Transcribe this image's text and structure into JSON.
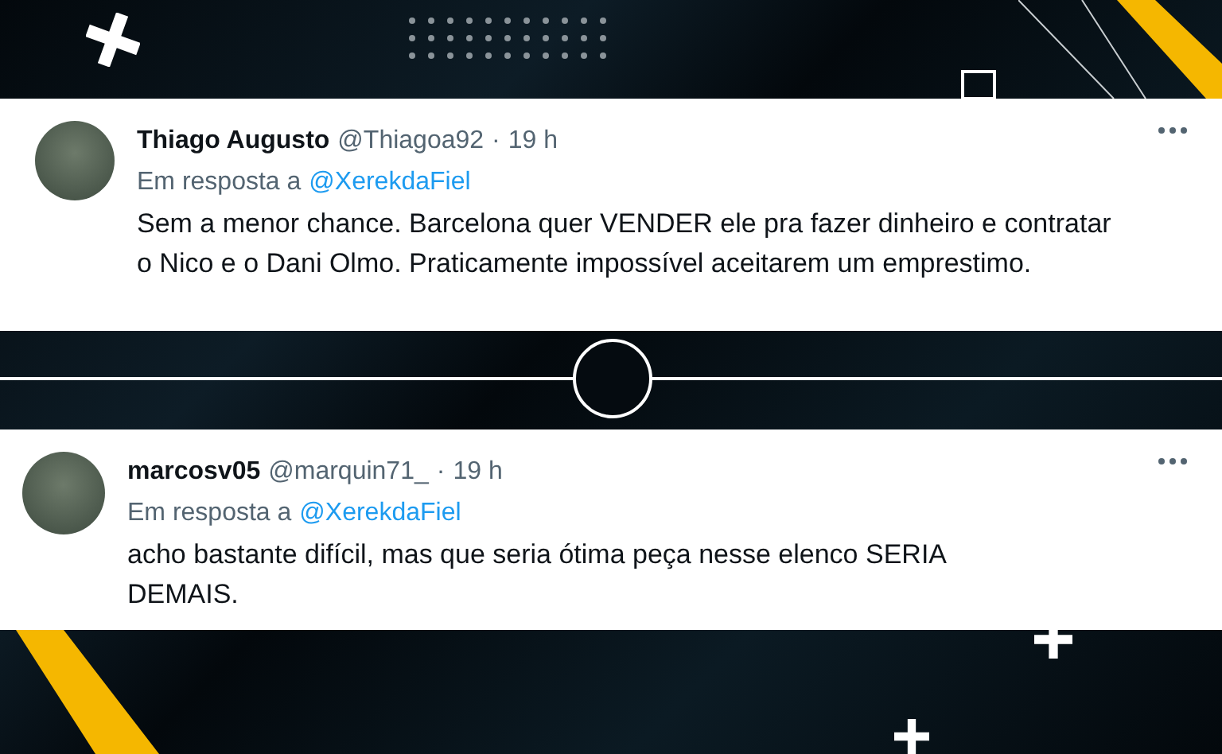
{
  "tweets": [
    {
      "name": "Thiago Augusto",
      "handle": "@Thiagoa92",
      "separator": "·",
      "time": "19 h",
      "reply_prefix": "Em resposta a",
      "reply_to": "@XerekdaFiel",
      "text": "Sem a menor chance. Barcelona quer VENDER ele pra fazer dinheiro e contratar o Nico e o Dani Olmo. Praticamente impossível aceitarem um emprestimo."
    },
    {
      "name": "marcosv05",
      "handle": "@marquin71_",
      "separator": "·",
      "time": "19 h",
      "reply_prefix": "Em resposta a",
      "reply_to": "@XerekdaFiel",
      "text": "acho bastante difícil, mas que seria ótima peça nesse elenco SERIA DEMAIS."
    }
  ]
}
